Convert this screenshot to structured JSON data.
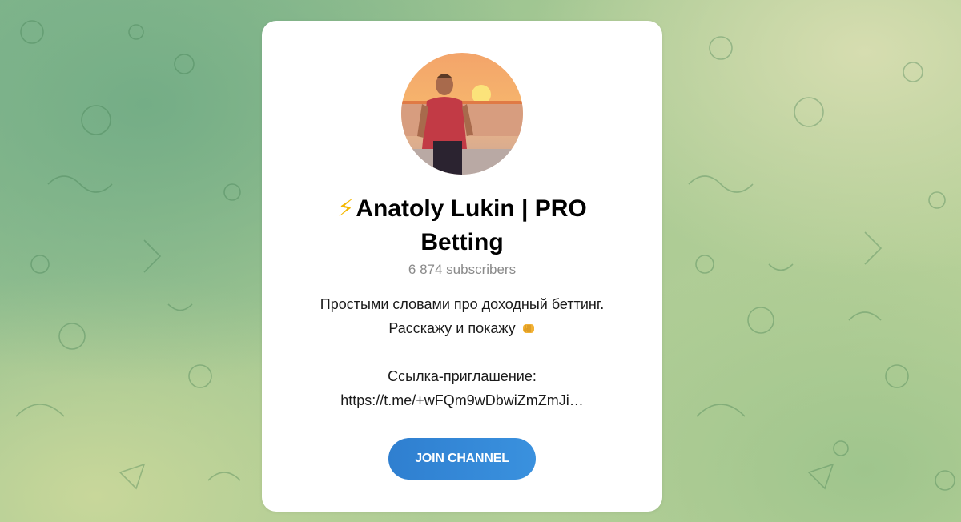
{
  "channel": {
    "title_emoji": "⚡",
    "title": "Anatoly Lukin | PRO Betting",
    "subscribers": "6 874 subscribers",
    "description": {
      "line1": "Простыми словами про доходный беттинг.",
      "line2": "Расскажу и покажу",
      "line2_emoji": "fist-bump-icon",
      "line3": "Ссылка-приглашение:",
      "line4": "https://t.me/+wFQm9wDbwiZmZmJi…"
    },
    "join_button_label": "JOIN CHANNEL"
  },
  "colors": {
    "accent": "#3a8ddc",
    "title": "#000000",
    "subscribers": "#8a8a8a",
    "card_bg": "#ffffff"
  },
  "avatar": {
    "icon": "channel-avatar-photo"
  }
}
